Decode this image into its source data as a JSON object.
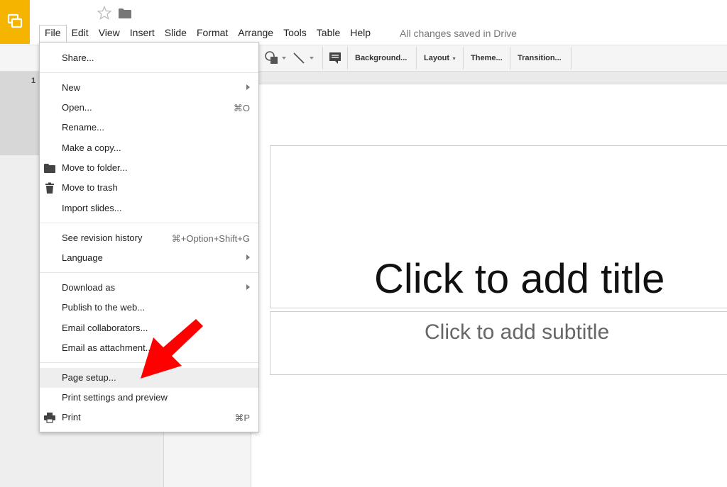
{
  "header": {
    "menu": [
      "File",
      "Edit",
      "View",
      "Insert",
      "Slide",
      "Format",
      "Arrange",
      "Tools",
      "Table",
      "Help"
    ],
    "save_status": "All changes saved in Drive"
  },
  "toolbar": {
    "background": "Background...",
    "layout": "Layout",
    "theme": "Theme...",
    "transition": "Transition..."
  },
  "filmstrip": {
    "slide_number": "1"
  },
  "slide": {
    "title_placeholder": "Click to add title",
    "subtitle_placeholder": "Click to add subtitle"
  },
  "file_menu": {
    "share": "Share...",
    "new": "New",
    "open": "Open...",
    "open_shortcut": "⌘O",
    "rename": "Rename...",
    "make_copy": "Make a copy...",
    "move_to_folder": "Move to folder...",
    "move_to_trash": "Move to trash",
    "import_slides": "Import slides...",
    "revision_history": "See revision history",
    "revision_history_shortcut": "⌘+Option+Shift+G",
    "language": "Language",
    "download_as": "Download as",
    "publish": "Publish to the web...",
    "email_collaborators": "Email collaborators...",
    "email_attachment": "Email as attachment...",
    "page_setup": "Page setup...",
    "print_settings": "Print settings and preview",
    "print": "Print",
    "print_shortcut": "⌘P"
  },
  "colors": {
    "brand": "#f4b400",
    "annotation_arrow": "#ff0000",
    "menu_highlight": "#eeeeee"
  }
}
